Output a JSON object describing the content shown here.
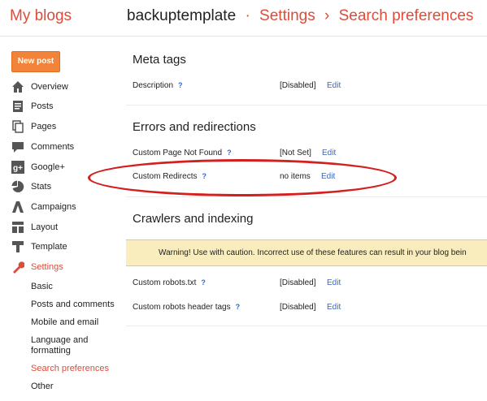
{
  "header": {
    "my_blogs": "My blogs",
    "blog_name": "backuptemplate",
    "sep1": "·",
    "settings": "Settings",
    "sep2": "›",
    "page": "Search preferences"
  },
  "new_post": "New post",
  "nav": [
    {
      "label": "Overview",
      "icon": "home-icon"
    },
    {
      "label": "Posts",
      "icon": "posts-icon"
    },
    {
      "label": "Pages",
      "icon": "pages-icon"
    },
    {
      "label": "Comments",
      "icon": "comments-icon"
    },
    {
      "label": "Google+",
      "icon": "google-plus-icon"
    },
    {
      "label": "Stats",
      "icon": "stats-icon"
    },
    {
      "label": "Campaigns",
      "icon": "campaigns-icon"
    },
    {
      "label": "Layout",
      "icon": "layout-icon"
    },
    {
      "label": "Template",
      "icon": "template-icon"
    },
    {
      "label": "Settings",
      "icon": "wrench-icon"
    }
  ],
  "settings_sub": [
    "Basic",
    "Posts and comments",
    "Mobile and email",
    "Language and formatting",
    "Search preferences",
    "Other"
  ],
  "meta": {
    "title": "Meta tags",
    "description_label": "Description",
    "description_value": "[Disabled]",
    "edit": "Edit"
  },
  "errors": {
    "title": "Errors and redirections",
    "not_found_label": "Custom Page Not Found",
    "not_found_value": "[Not Set]",
    "redirects_label": "Custom Redirects",
    "redirects_value": "no items",
    "edit": "Edit"
  },
  "crawlers": {
    "title": "Crawlers and indexing",
    "warning": "Warning! Use with caution. Incorrect use of these features can result in your blog bein",
    "robots_label": "Custom robots.txt",
    "robots_value": "[Disabled]",
    "header_tags_label": "Custom robots header tags",
    "header_tags_value": "[Disabled]",
    "edit": "Edit"
  },
  "help": "?",
  "colors": {
    "accent": "#dd4b39",
    "link": "#3366cc",
    "highlight": "#d41f1f"
  }
}
